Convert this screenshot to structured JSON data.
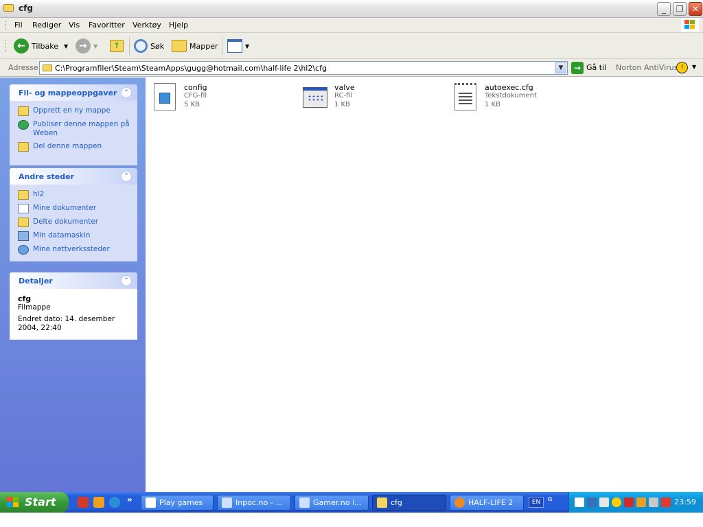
{
  "window": {
    "title": "cfg"
  },
  "menu": [
    "Fil",
    "Rediger",
    "Vis",
    "Favoritter",
    "Verktøy",
    "Hjelp"
  ],
  "toolbar": {
    "back": "Tilbake",
    "search": "Søk",
    "folders": "Mapper"
  },
  "address": {
    "label": "Adresse",
    "path": "C:\\Programfiler\\Steam\\SteamApps\\gugg@hotmail.com\\half-life 2\\hl2\\cfg",
    "go": "Gå til",
    "norton": "Norton AntiVirus"
  },
  "tasks_panel": {
    "title": "Fil- og mappeoppgaver",
    "items": [
      "Opprett en ny mappe",
      "Publiser denne mappen på Weben",
      "Del denne mappen"
    ]
  },
  "places_panel": {
    "title": "Andre steder",
    "items": [
      "hl2",
      "Mine dokumenter",
      "Delte dokumenter",
      "Min datamaskin",
      "Mine nettverkssteder"
    ]
  },
  "details_panel": {
    "title": "Detaljer",
    "name": "cfg",
    "type": "Filmappe",
    "modified": "Endret dato: 14. desember 2004, 22:40"
  },
  "files": [
    {
      "name": "config",
      "type": "CFG-fil",
      "size": "5 KB"
    },
    {
      "name": "valve",
      "type": "RC-fil",
      "size": "1 KB"
    },
    {
      "name": "autoexec.cfg",
      "type": "Tekstdokument",
      "size": "1 KB"
    }
  ],
  "taskbar": {
    "start": "Start",
    "tasks": [
      "Play games",
      "Inpoc.no - ...",
      "Gamer.no i...",
      "cfg",
      "HALF-LIFE 2"
    ],
    "lang": "EN",
    "clock": "23:59"
  }
}
